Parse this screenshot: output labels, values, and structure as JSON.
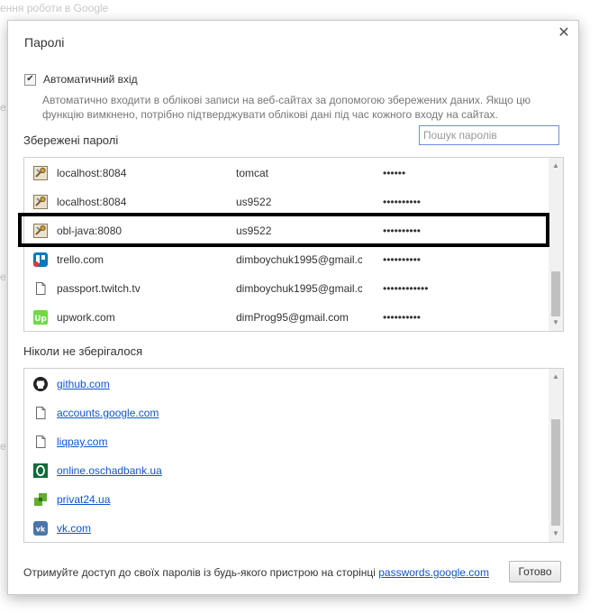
{
  "background": {
    "text": "ення роботи в Google"
  },
  "dialog": {
    "title": "Паролі",
    "close_glyph": "✕",
    "autologin": {
      "checked": true,
      "label": "Автоматичний вхід",
      "description": "Автоматично входити в облікові записи на веб-сайтах за допомогою збережених даних. Якщо цю функцію вимкнено, потрібно підтверджувати облікові дані під час кожного входу на сайтах."
    },
    "saved": {
      "title": "Збережені паролі",
      "search_placeholder": "Пошук паролів",
      "rows": [
        {
          "site": "localhost:8084",
          "user": "tomcat",
          "password": "••••••",
          "icon": "generic-key-icon"
        },
        {
          "site": "localhost:8084",
          "user": "us9522",
          "password": "••••••••••",
          "icon": "generic-key-icon"
        },
        {
          "site": "obl-java:8080",
          "user": "us9522",
          "password": "••••••••••",
          "icon": "generic-key-icon"
        },
        {
          "site": "trello.com",
          "user": "dimboychuk1995@gmail.c",
          "password": "••••••••••",
          "icon": "trello-icon"
        },
        {
          "site": "passport.twitch.tv",
          "user": "dimboychuk1995@gmail.c",
          "password": "••••••••••••",
          "icon": "page-icon"
        },
        {
          "site": "upwork.com",
          "user": "dimProg95@gmail.com",
          "password": "••••••••••",
          "icon": "upwork-icon"
        }
      ],
      "highlighted_row": 2
    },
    "never": {
      "title": "Ніколи не зберігалося",
      "rows": [
        {
          "site": "github.com",
          "icon": "github-icon"
        },
        {
          "site": "accounts.google.com",
          "icon": "page-icon"
        },
        {
          "site": "liqpay.com",
          "icon": "page-icon"
        },
        {
          "site": "online.oschadbank.ua",
          "icon": "oschadbank-icon"
        },
        {
          "site": "privat24.ua",
          "icon": "privat24-icon"
        },
        {
          "site": "vk.com",
          "icon": "vk-icon"
        }
      ]
    },
    "footer": {
      "text": "Отримуйте доступ до своїх паролів із будь-якого пристрою на сторінці ",
      "link": "passwords.google.com",
      "done_label": "Готово"
    }
  },
  "colors": {
    "link": "#1155cc",
    "upwork": "#6fda44",
    "trello": "#0079bf",
    "vk": "#4a76a8",
    "oschad": "#0e6b3a",
    "privat": "#5fae2f"
  }
}
